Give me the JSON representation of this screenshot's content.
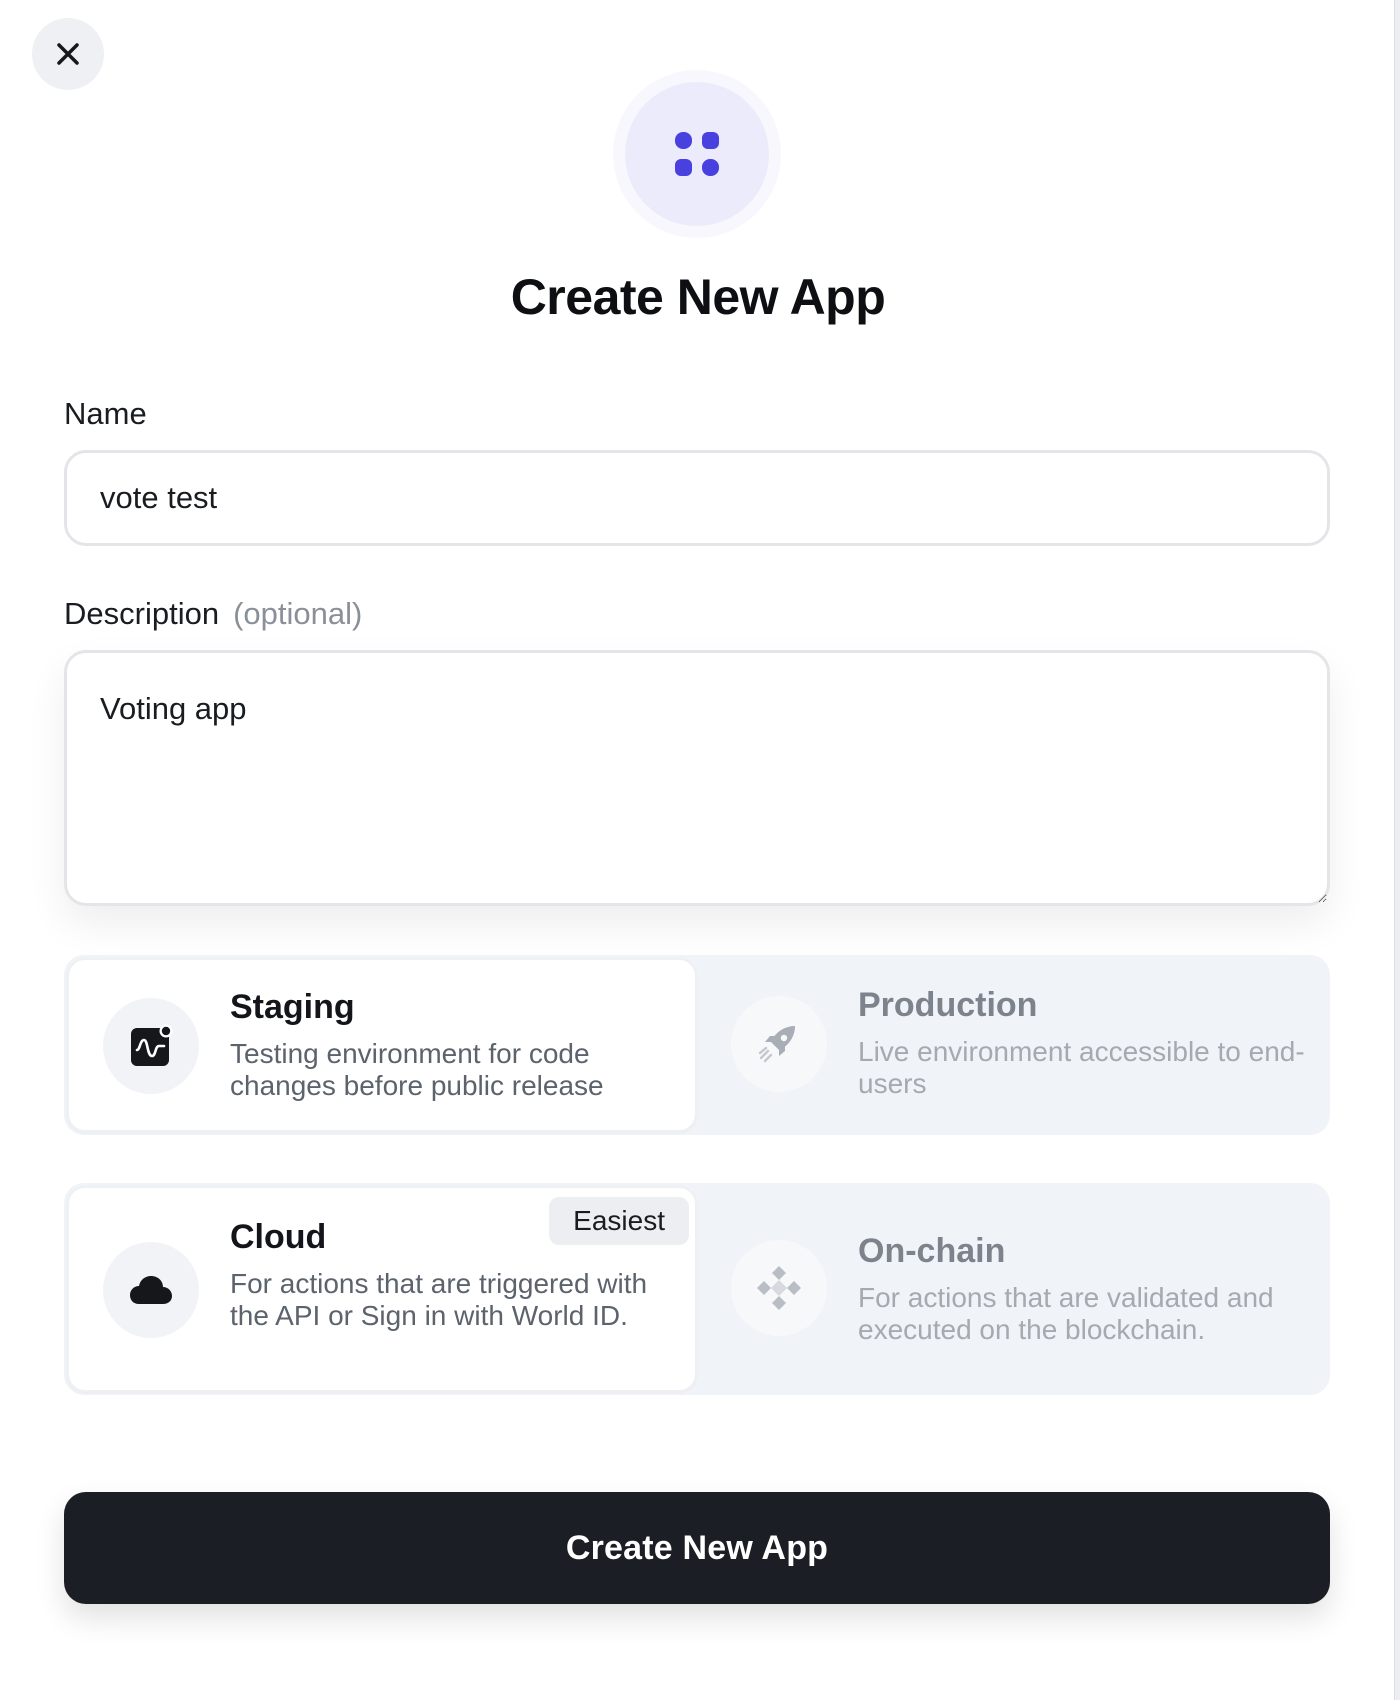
{
  "dialog": {
    "title": "Create New App",
    "accent_color": "#4940e0",
    "icons": {
      "close": "close-icon",
      "app": "apps-grid-icon"
    }
  },
  "form": {
    "name": {
      "label": "Name",
      "value": "vote test"
    },
    "description": {
      "label": "Description",
      "optional_hint": "(optional)",
      "value": "Voting app"
    }
  },
  "environment": {
    "selected": "staging",
    "options": [
      {
        "id": "staging",
        "title": "Staging",
        "description": "Testing environment for code changes before public release",
        "icon": "pulse-chip-icon"
      },
      {
        "id": "production",
        "title": "Production",
        "description": "Live environment accessible to end-users",
        "icon": "rocket-icon"
      }
    ]
  },
  "engine": {
    "selected": "cloud",
    "options": [
      {
        "id": "cloud",
        "title": "Cloud",
        "badge": "Easiest",
        "description": "For actions that are triggered with the API or Sign in with World ID.",
        "icon": "cloud-icon"
      },
      {
        "id": "onchain",
        "title": "On-chain",
        "description": "For actions that are validated and executed on the blockchain.",
        "icon": "ethereum-diamond-icon"
      }
    ]
  },
  "submit": {
    "label": "Create New App"
  }
}
